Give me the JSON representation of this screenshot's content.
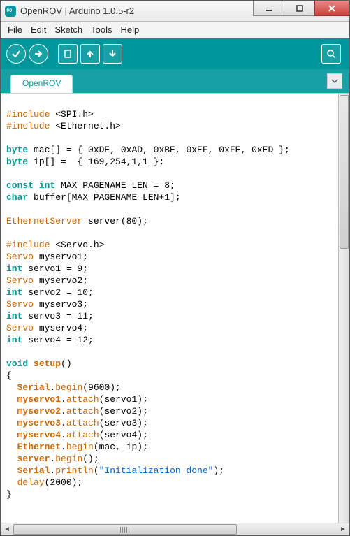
{
  "window": {
    "title": "OpenROV | Arduino 1.0.5-r2"
  },
  "menubar": {
    "file": "File",
    "edit": "Edit",
    "sketch": "Sketch",
    "tools": "Tools",
    "help": "Help"
  },
  "toolbar_icons": {
    "verify": "verify-icon",
    "upload": "upload-icon",
    "new": "new-icon",
    "open": "open-icon",
    "save": "save-icon",
    "serial": "serial-monitor-icon"
  },
  "tab": {
    "name": "OpenROV"
  },
  "code": {
    "lines": [
      {
        "t": "plain",
        "s": ""
      },
      {
        "t": "include",
        "s": "#include <SPI.h>"
      },
      {
        "t": "include",
        "s": "#include <Ethernet.h>"
      },
      {
        "t": "plain",
        "s": ""
      },
      {
        "t": "decl",
        "pre": "byte",
        "rest": " mac[] = { 0xDE, 0xAD, 0xBE, 0xEF, 0xFE, 0xED };"
      },
      {
        "t": "decl",
        "pre": "byte",
        "rest": " ip[] =  { 169,254,1,1 };"
      },
      {
        "t": "plain",
        "s": ""
      },
      {
        "t": "decl2",
        "pre": "const int",
        "mid": " MAX_PAGENAME_LEN = 8;"
      },
      {
        "t": "decl",
        "pre": "char",
        "rest": " buffer[MAX_PAGENAME_LEN+1];"
      },
      {
        "t": "plain",
        "s": ""
      },
      {
        "t": "obj",
        "pre": "EthernetServer",
        "rest": " server(80);"
      },
      {
        "t": "plain",
        "s": ""
      },
      {
        "t": "include",
        "s": "#include <Servo.h>"
      },
      {
        "t": "obj",
        "pre": "Servo",
        "rest": " myservo1;"
      },
      {
        "t": "decl",
        "pre": "int",
        "rest": " servo1 = 9;"
      },
      {
        "t": "obj",
        "pre": "Servo",
        "rest": " myservo2;"
      },
      {
        "t": "decl",
        "pre": "int",
        "rest": " servo2 = 10;"
      },
      {
        "t": "obj",
        "pre": "Servo",
        "rest": " myservo3;"
      },
      {
        "t": "decl",
        "pre": "int",
        "rest": " servo3 = 11;"
      },
      {
        "t": "obj",
        "pre": "Servo",
        "rest": " myservo4;"
      },
      {
        "t": "decl",
        "pre": "int",
        "rest": " servo4 = 12;"
      },
      {
        "t": "plain",
        "s": ""
      },
      {
        "t": "func",
        "pre": "void",
        "name": "setup",
        "rest": "()"
      },
      {
        "t": "plain",
        "s": "{"
      },
      {
        "t": "call",
        "ind": "  ",
        "obj": "Serial",
        "meth": "begin",
        "args": "(9600);"
      },
      {
        "t": "call",
        "ind": "  ",
        "obj": "myservo1",
        "meth": "attach",
        "args": "(servo1);"
      },
      {
        "t": "call",
        "ind": "  ",
        "obj": "myservo2",
        "meth": "attach",
        "args": "(servo2);"
      },
      {
        "t": "call",
        "ind": "  ",
        "obj": "myservo3",
        "meth": "attach",
        "args": "(servo3);"
      },
      {
        "t": "call",
        "ind": "  ",
        "obj": "myservo4",
        "meth": "attach",
        "args": "(servo4);"
      },
      {
        "t": "call",
        "ind": "  ",
        "obj": "Ethernet",
        "meth": "begin",
        "args": "(mac, ip);"
      },
      {
        "t": "call",
        "ind": "  ",
        "obj": "server",
        "meth": "begin",
        "args": "();"
      },
      {
        "t": "callstr",
        "ind": "  ",
        "obj": "Serial",
        "meth": "println",
        "pre": "(",
        "str": "\"Initialization done\"",
        "post": ");"
      },
      {
        "t": "callbare",
        "ind": "  ",
        "meth": "delay",
        "args": "(2000);"
      },
      {
        "t": "plain",
        "s": "}"
      }
    ]
  }
}
